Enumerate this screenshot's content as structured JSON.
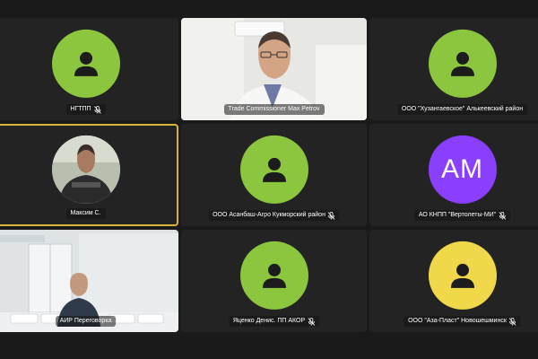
{
  "theme": {
    "background": "#1a1a1a",
    "tile": "#232323",
    "active_border": "#d9b43a",
    "green_avatar": "#8cc63f",
    "purple_avatar": "#8a3ffc",
    "yellow_avatar": "#f0d84a",
    "person_icon": "#1c1c1c"
  },
  "participants": [
    {
      "name": "НГТПП",
      "muted": true,
      "avatar": "person-icon",
      "color": "#8cc63f"
    },
    {
      "name": "Trade Commissioner Max Petrov",
      "muted": false,
      "avatar": "video"
    },
    {
      "name": "ООО \"Хузангаевское\" Алькеевский район",
      "muted": false,
      "avatar": "person-icon",
      "color": "#8cc63f"
    },
    {
      "name": "Максим С.",
      "muted": false,
      "avatar": "photo",
      "active": true
    },
    {
      "name": "ООО Асанбаш-Агро Кукморский район",
      "muted": true,
      "avatar": "person-icon",
      "color": "#8cc63f"
    },
    {
      "name": "АО КНПП \"Вертолеты-МИ\"",
      "muted": true,
      "avatar": "initials",
      "initials": "AM",
      "color": "#8a3ffc"
    },
    {
      "name": "АИР Переговорка",
      "muted": false,
      "avatar": "video"
    },
    {
      "name": "Яценко Денис. ПП АКОР",
      "muted": true,
      "avatar": "person-icon",
      "color": "#8cc63f"
    },
    {
      "name": "ООО \"Аза-Пласт\" Новошешминск",
      "muted": true,
      "avatar": "person-icon",
      "color": "#f0d84a"
    }
  ]
}
